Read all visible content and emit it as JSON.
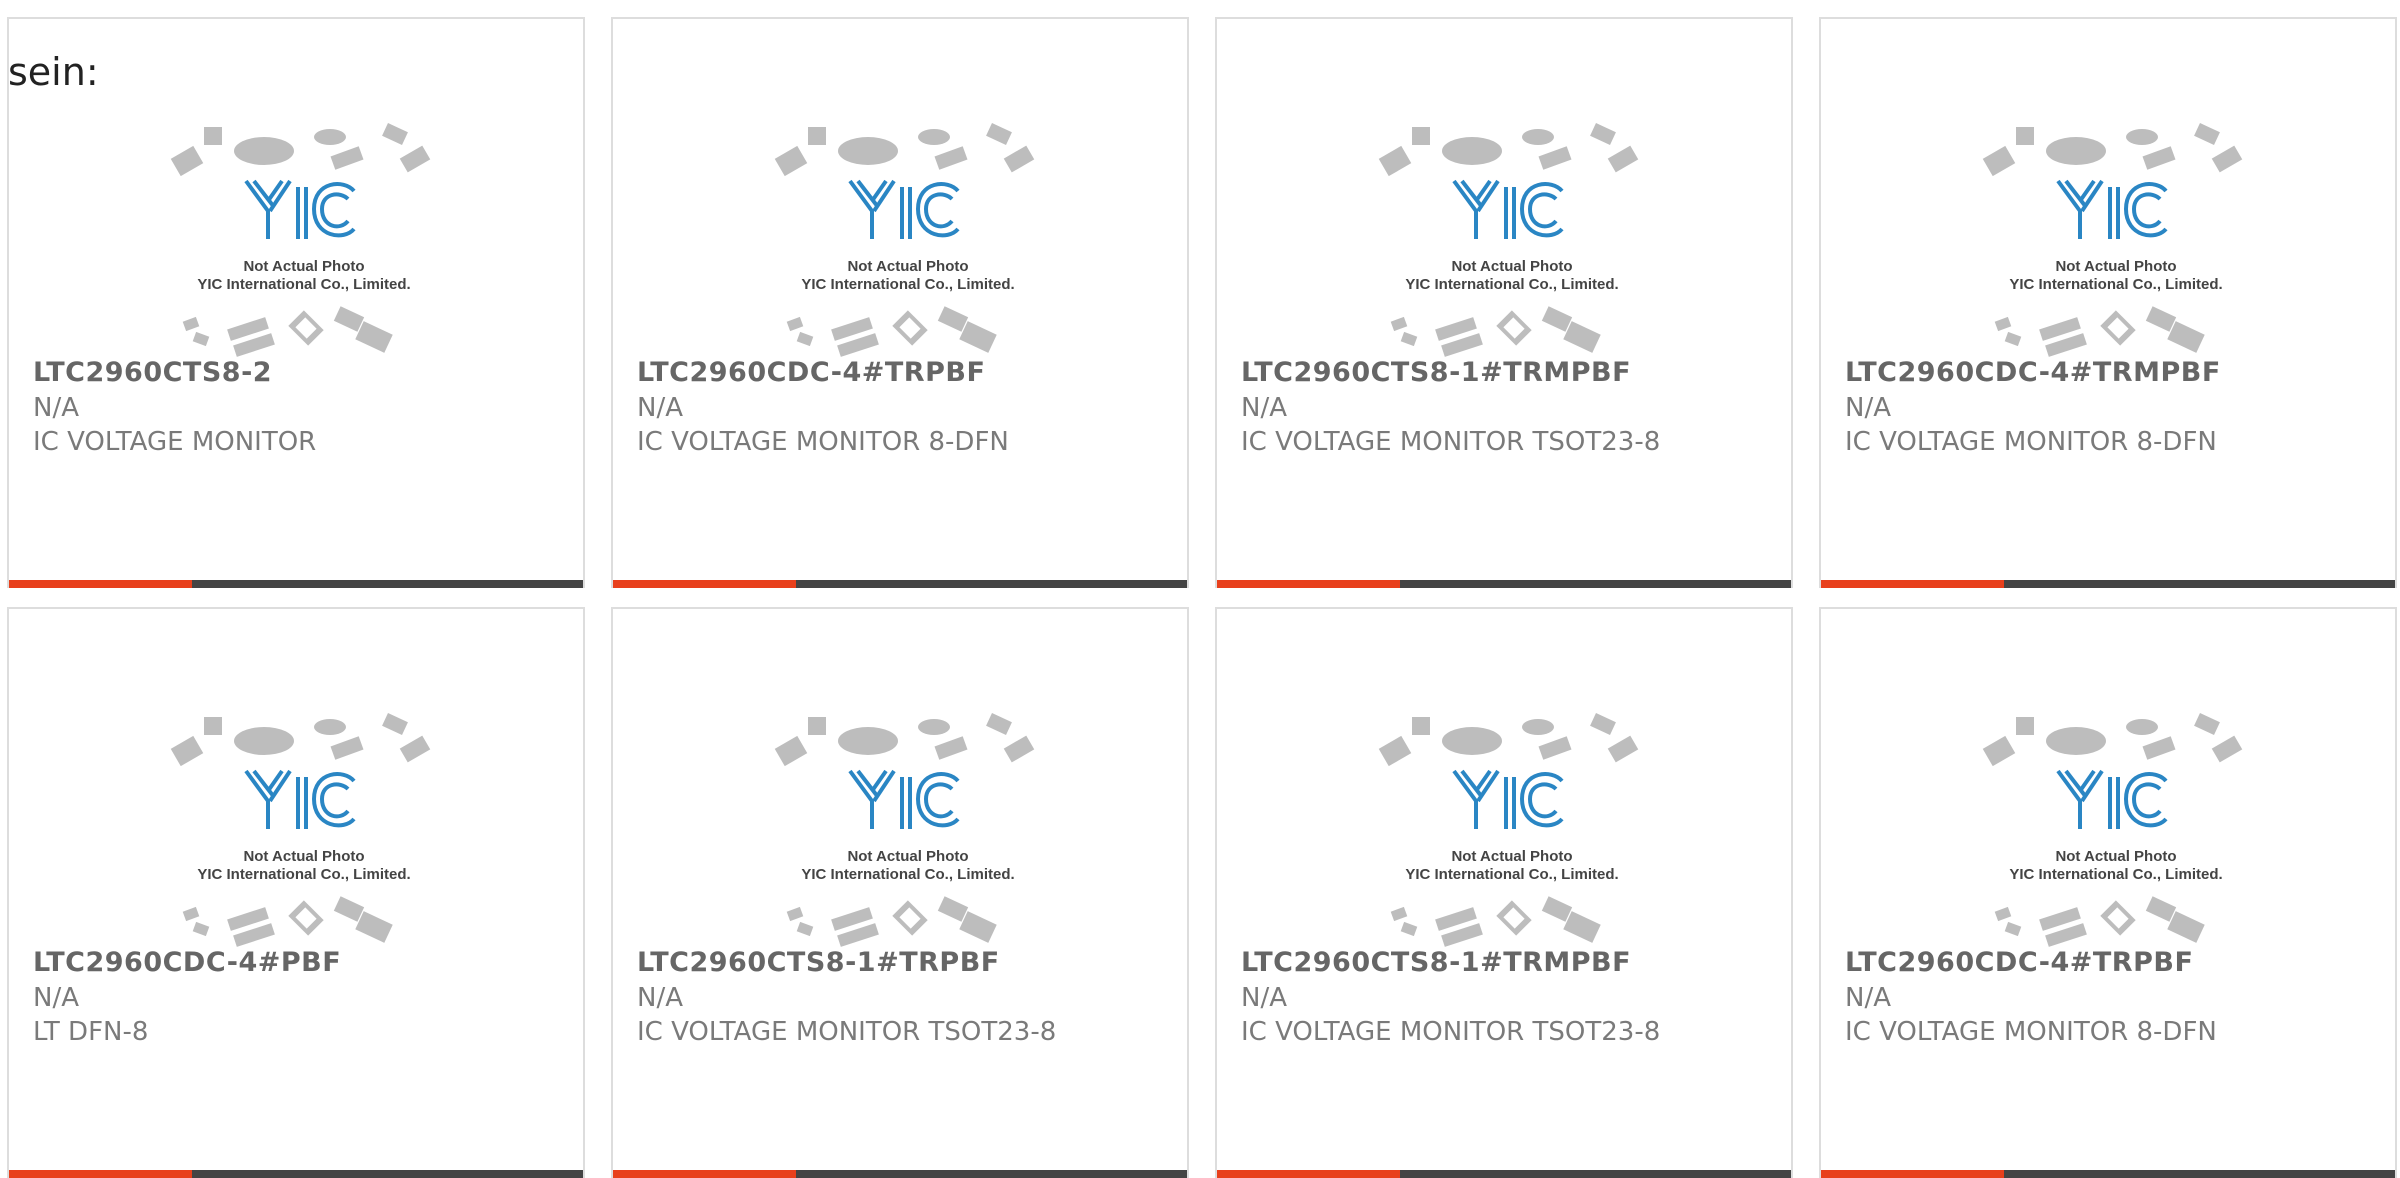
{
  "page": {
    "caption": "sein:"
  },
  "placeholder": {
    "line1": "Not Actual Photo",
    "line2": "YIC International Co., Limited.",
    "logo": "YIC"
  },
  "colors": {
    "accent": "#e8401c",
    "bar": "#444444",
    "logo_blue": "#2a86c4"
  },
  "products": [
    {
      "part_number": "LTC2960CTS8-2",
      "manufacturer": "N/A",
      "description": "IC VOLTAGE MONITOR"
    },
    {
      "part_number": "LTC2960CDC-4#TRPBF",
      "manufacturer": "N/A",
      "description": "IC VOLTAGE MONITOR 8-DFN"
    },
    {
      "part_number": "LTC2960CTS8-1#TRMPBF",
      "manufacturer": "N/A",
      "description": "IC VOLTAGE MONITOR TSOT23-8"
    },
    {
      "part_number": "LTC2960CDC-4#TRMPBF",
      "manufacturer": "N/A",
      "description": "IC VOLTAGE MONITOR 8-DFN"
    },
    {
      "part_number": "LTC2960CDC-4#PBF",
      "manufacturer": "N/A",
      "description": "LT DFN-8"
    },
    {
      "part_number": "LTC2960CTS8-1#TRPBF",
      "manufacturer": "N/A",
      "description": "IC VOLTAGE MONITOR TSOT23-8"
    },
    {
      "part_number": "LTC2960CTS8-1#TRMPBF",
      "manufacturer": "N/A",
      "description": "IC VOLTAGE MONITOR TSOT23-8"
    },
    {
      "part_number": "LTC2960CDC-4#TRPBF",
      "manufacturer": "N/A",
      "description": "IC VOLTAGE MONITOR 8-DFN"
    }
  ]
}
